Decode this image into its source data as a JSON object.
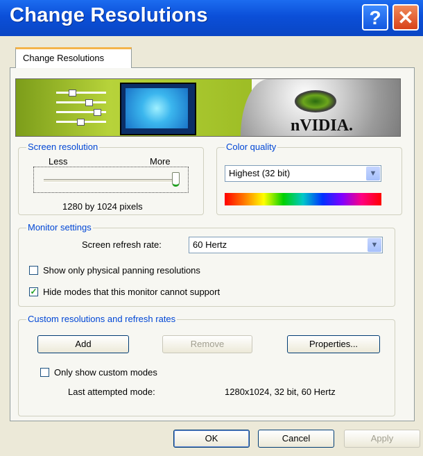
{
  "window": {
    "title": "Change Resolutions",
    "help_glyph": "?",
    "close_glyph": "✕"
  },
  "tab": {
    "label": "Change Resolutions"
  },
  "banner": {
    "brand": "nVIDIA."
  },
  "screen_resolution": {
    "legend": "Screen resolution",
    "less_label": "Less",
    "more_label": "More",
    "slider_position": 1.0,
    "value_text": "1280 by 1024 pixels"
  },
  "color_quality": {
    "legend": "Color quality",
    "selected": "Highest (32 bit)"
  },
  "monitor_settings": {
    "legend": "Monitor settings",
    "refresh_label": "Screen refresh rate:",
    "refresh_value": "60 Hertz",
    "physical_panning": {
      "label": "Show only physical panning resolutions",
      "checked": false
    },
    "hide_modes": {
      "label": "Hide modes that this monitor cannot support",
      "checked": true
    }
  },
  "custom": {
    "legend": "Custom resolutions and refresh rates",
    "add_label": "Add",
    "remove_label": "Remove",
    "properties_label": "Properties...",
    "only_custom": {
      "label": "Only show custom modes",
      "checked": false
    },
    "last_label": "Last attempted mode:",
    "last_value": "1280x1024, 32 bit, 60 Hertz"
  },
  "footer": {
    "ok_label": "OK",
    "cancel_label": "Cancel",
    "apply_label": "Apply"
  },
  "colors": {
    "title_bar": "#0b4fd8",
    "accent_legend": "#0046d5",
    "dialog_bg": "#ece9d8",
    "nvidia_green": "#7c9d1a"
  }
}
